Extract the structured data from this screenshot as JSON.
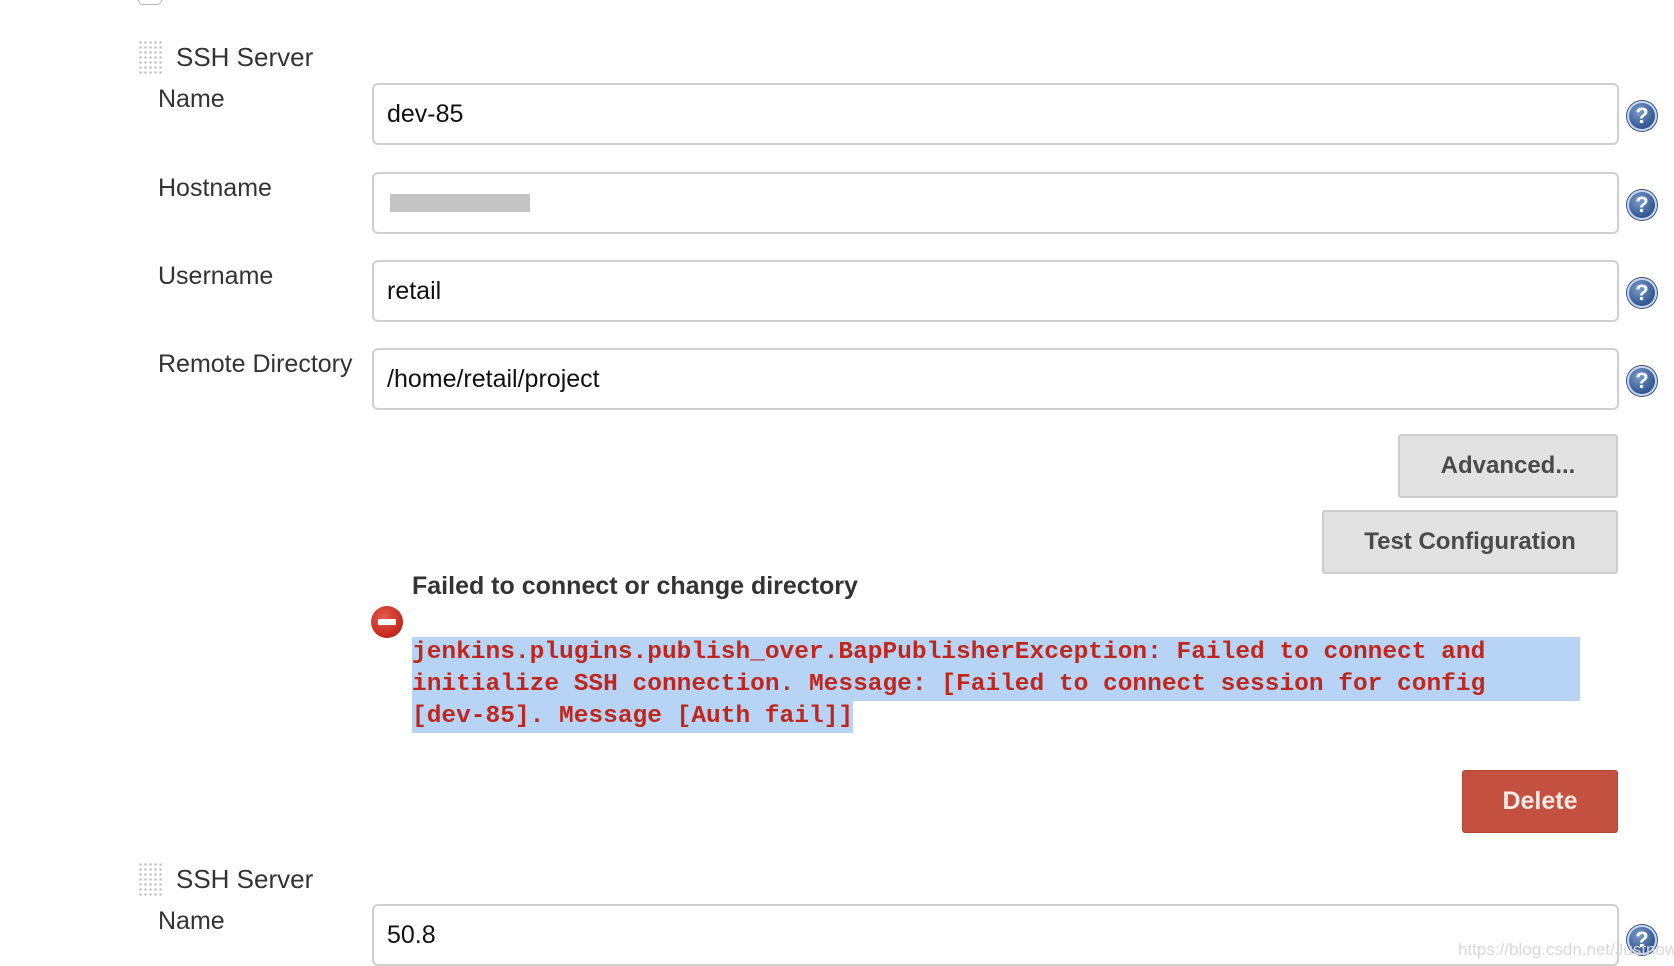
{
  "servers": [
    {
      "section_title": "SSH Server",
      "fields": [
        {
          "label": "Name",
          "value": "dev-85"
        },
        {
          "label": "Hostname",
          "value": ""
        },
        {
          "label": "Username",
          "value": "retail"
        },
        {
          "label": "Remote Directory",
          "value": "/home/retail/project"
        }
      ],
      "buttons": {
        "advanced": "Advanced...",
        "test_configuration": "Test Configuration",
        "delete": "Delete"
      },
      "error": {
        "heading": "Failed to connect or change directory",
        "lines": [
          "jenkins.plugins.publish_over.BapPublisherException: Failed to connect and",
          "initialize SSH connection. Message: [Failed to connect session for config",
          "[dev-85]. Message [Auth fail]]"
        ]
      }
    },
    {
      "section_title": "SSH Server",
      "fields": [
        {
          "label": "Name",
          "value": "50.8"
        }
      ]
    }
  ],
  "help_icon_glyph": "?",
  "watermark": "https://blog.csdn.net/Justnow_",
  "colors": {
    "delete_button": "#c4503f",
    "error_text": "#c0261c",
    "selection_highlight": "#b7d4f7",
    "help_icon": "#3a5f9a"
  }
}
